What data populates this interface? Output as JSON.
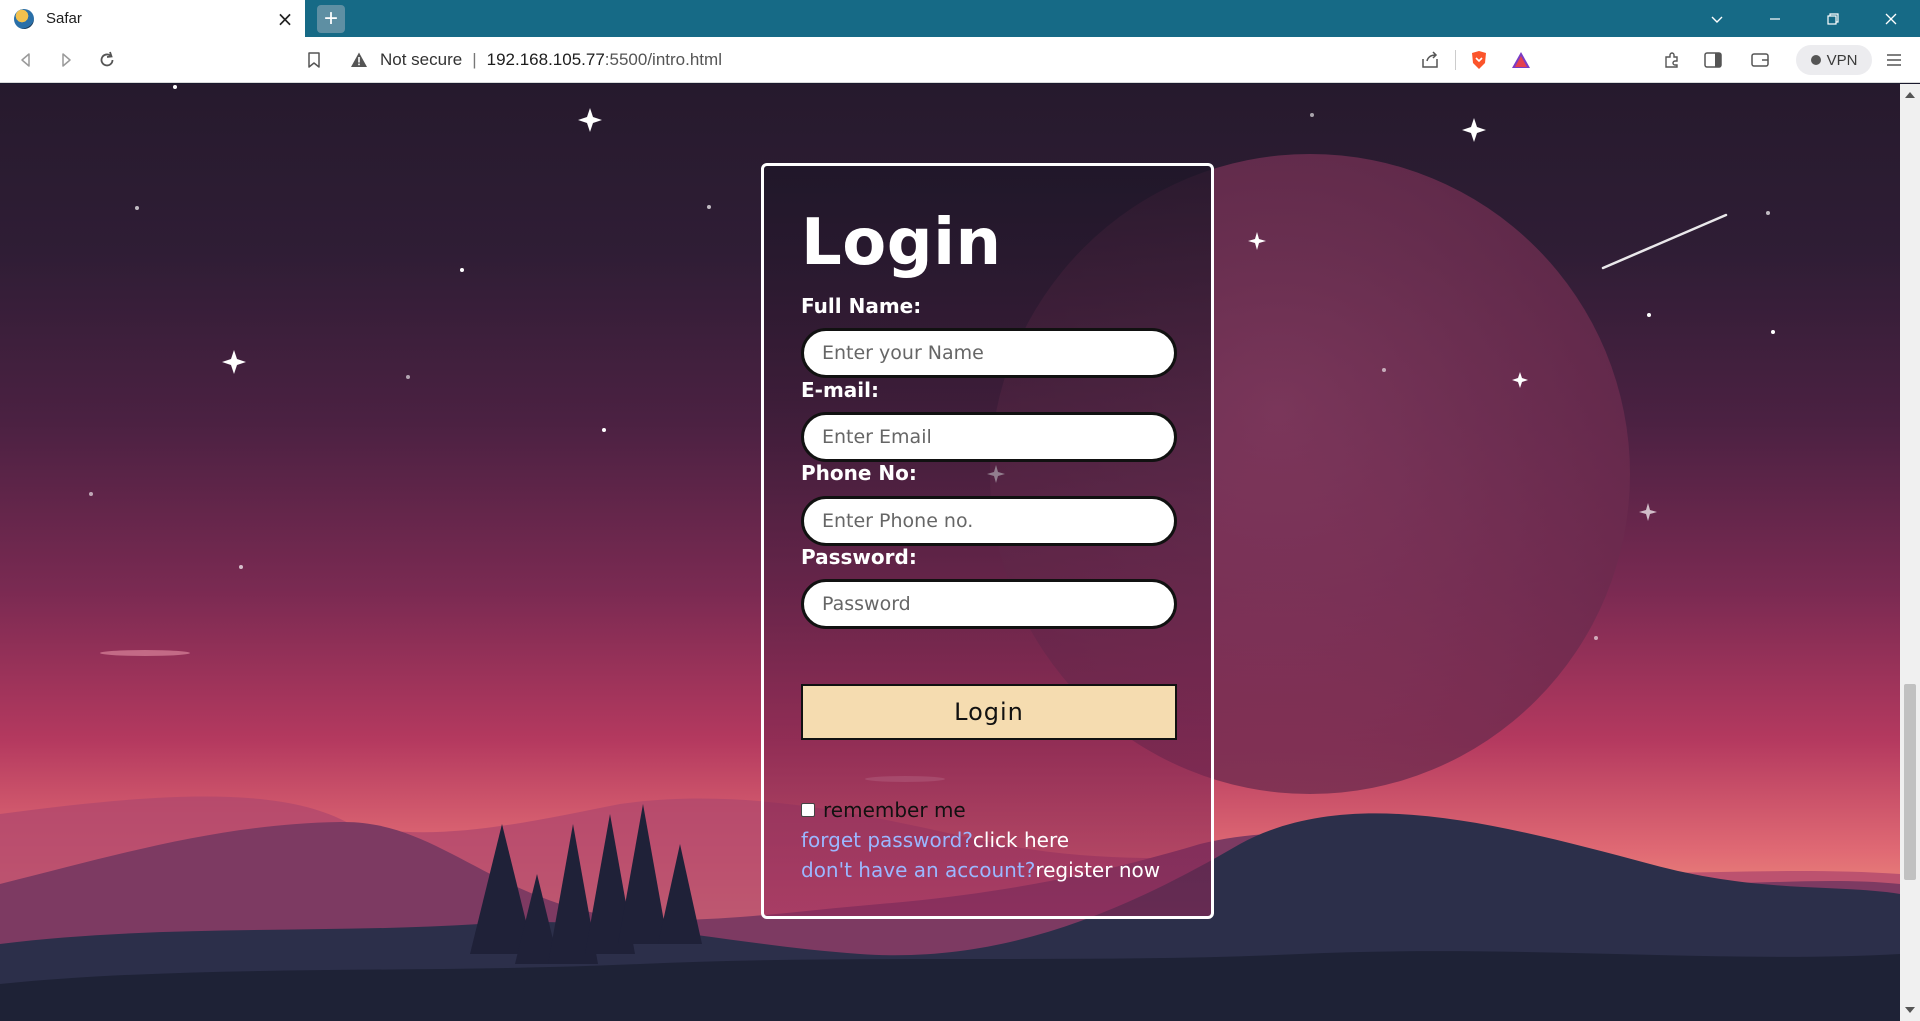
{
  "browser": {
    "tab_title": "Safar",
    "new_tab_symbol": "+",
    "close_symbol": "×",
    "security_label": "Not secure",
    "separator": "|",
    "url_host": "192.168.105.77",
    "url_path": ":5500/intro.html",
    "vpn_label": "VPN"
  },
  "form": {
    "title": "Login",
    "fields": [
      {
        "label": "Full Name:",
        "placeholder": "Enter your Name"
      },
      {
        "label": "E-mail:",
        "placeholder": "Enter Email"
      },
      {
        "label": "Phone No:",
        "placeholder": "Enter Phone no."
      },
      {
        "label": "Password:",
        "placeholder": "Password"
      }
    ],
    "submit_label": "Login",
    "remember_label": "remember me",
    "forgot_prefix": "forget password?",
    "forgot_link": "click here",
    "register_prefix": "don't have an account?",
    "register_link": "register now"
  },
  "colors": {
    "tab_strip": "#166a86",
    "button_fill": "#f5dcb0",
    "link_muted": "#9bb7ff"
  }
}
